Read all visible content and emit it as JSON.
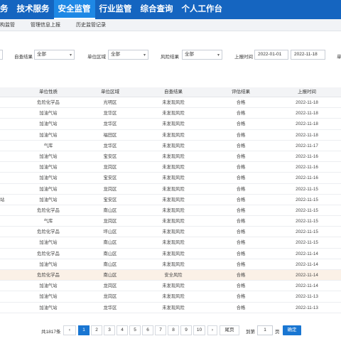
{
  "nav": {
    "items": [
      {
        "label": "务"
      },
      {
        "label": "技术服务"
      },
      {
        "label": "安全监管"
      },
      {
        "label": "行业监管"
      },
      {
        "label": "综合查询"
      },
      {
        "label": "个人工作台"
      }
    ],
    "active_index": 2
  },
  "subnav": {
    "items": [
      {
        "label": "构监管"
      },
      {
        "label": "管理信息上报"
      },
      {
        "label": "历史监管记录"
      }
    ]
  },
  "filters": {
    "self_check_label": "自查结果",
    "self_check_value": "全部",
    "region_label": "单位区域",
    "region_value": "全部",
    "risk_label": "风险结果",
    "risk_value": "全部",
    "report_time_label": "上报时间",
    "date_from": "2022-01-01",
    "date_to": "2022-11-18",
    "cut_label": "单"
  },
  "table": {
    "headers": [
      "单位性质",
      "单位区域",
      "自查结果",
      "评估结果",
      "上报时间"
    ],
    "rows": [
      {
        "lead": "",
        "type": "危险化学品",
        "region": "光明区",
        "self": "未发现风险",
        "eval": "合格",
        "time": "2022-11-18"
      },
      {
        "lead": "",
        "type": "加油气站",
        "region": "龙华区",
        "self": "未发现风险",
        "eval": "合格",
        "time": "2022-11-18"
      },
      {
        "lead": "",
        "type": "加油气站",
        "region": "龙华区",
        "self": "未发现风险",
        "eval": "合格",
        "time": "2022-11-18"
      },
      {
        "lead": "",
        "type": "加油气站",
        "region": "福田区",
        "self": "未发现风险",
        "eval": "合格",
        "time": "2022-11-18"
      },
      {
        "lead": "",
        "type": "气库",
        "region": "龙华区",
        "self": "未发现风险",
        "eval": "合格",
        "time": "2022-11-17"
      },
      {
        "lead": "",
        "type": "加油气站",
        "region": "宝安区",
        "self": "未发现风险",
        "eval": "合格",
        "time": "2022-11-16"
      },
      {
        "lead": "",
        "type": "加油气站",
        "region": "龙岗区",
        "self": "未发现风险",
        "eval": "合格",
        "time": "2022-11-16"
      },
      {
        "lead": "",
        "type": "加油气站",
        "region": "宝安区",
        "self": "未发现风险",
        "eval": "合格",
        "time": "2022-11-16"
      },
      {
        "lead": "",
        "type": "加油气站",
        "region": "龙岗区",
        "self": "未发现风险",
        "eval": "合格",
        "time": "2022-11-15"
      },
      {
        "lead": "站",
        "type": "加油气站",
        "region": "宝安区",
        "self": "未发现风险",
        "eval": "合格",
        "time": "2022-11-15"
      },
      {
        "lead": "",
        "type": "危险化学品",
        "region": "南山区",
        "self": "未发现风险",
        "eval": "合格",
        "time": "2022-11-15"
      },
      {
        "lead": "",
        "type": "气库",
        "region": "龙岗区",
        "self": "未发现风险",
        "eval": "合格",
        "time": "2022-11-15"
      },
      {
        "lead": "",
        "type": "危险化学品",
        "region": "坪山区",
        "self": "未发现风险",
        "eval": "合格",
        "time": "2022-11-15"
      },
      {
        "lead": "",
        "type": "加油气站",
        "region": "南山区",
        "self": "未发现风险",
        "eval": "合格",
        "time": "2022-11-15"
      },
      {
        "lead": "",
        "type": "危险化学品",
        "region": "南山区",
        "self": "未发现风险",
        "eval": "合格",
        "time": "2022-11-14"
      },
      {
        "lead": "",
        "type": "加油气站",
        "region": "南山区",
        "self": "未发现风险",
        "eval": "合格",
        "time": "2022-11-14"
      },
      {
        "lead": "",
        "type": "危险化学品",
        "region": "南山区",
        "self": "安全风险",
        "eval": "合格",
        "time": "2022-11-14",
        "highlight": true
      },
      {
        "lead": "",
        "type": "加油气站",
        "region": "龙岗区",
        "self": "未发现风险",
        "eval": "合格",
        "time": "2022-11-14"
      },
      {
        "lead": "",
        "type": "加油气站",
        "region": "龙岗区",
        "self": "未发现风险",
        "eval": "合格",
        "time": "2022-11-13"
      },
      {
        "lead": "",
        "type": "加油气站",
        "region": "龙华区",
        "self": "未发现风险",
        "eval": "合格",
        "time": "2022-11-13"
      }
    ]
  },
  "pager": {
    "total": "共1817条",
    "prev": "‹",
    "pages": [
      "1",
      "2",
      "3",
      "4",
      "5",
      "6",
      "7",
      "8",
      "9",
      "10"
    ],
    "active_page": "1",
    "next": "›",
    "last": "尾页",
    "goto_label": "到第",
    "goto_value": "1",
    "page_suffix": "页",
    "confirm": "确定"
  },
  "colors": {
    "nav_bg": "#1565c0",
    "nav_active": "#1e88e5",
    "accent": "#1976d2",
    "highlight_row": "#fbf1e7"
  }
}
